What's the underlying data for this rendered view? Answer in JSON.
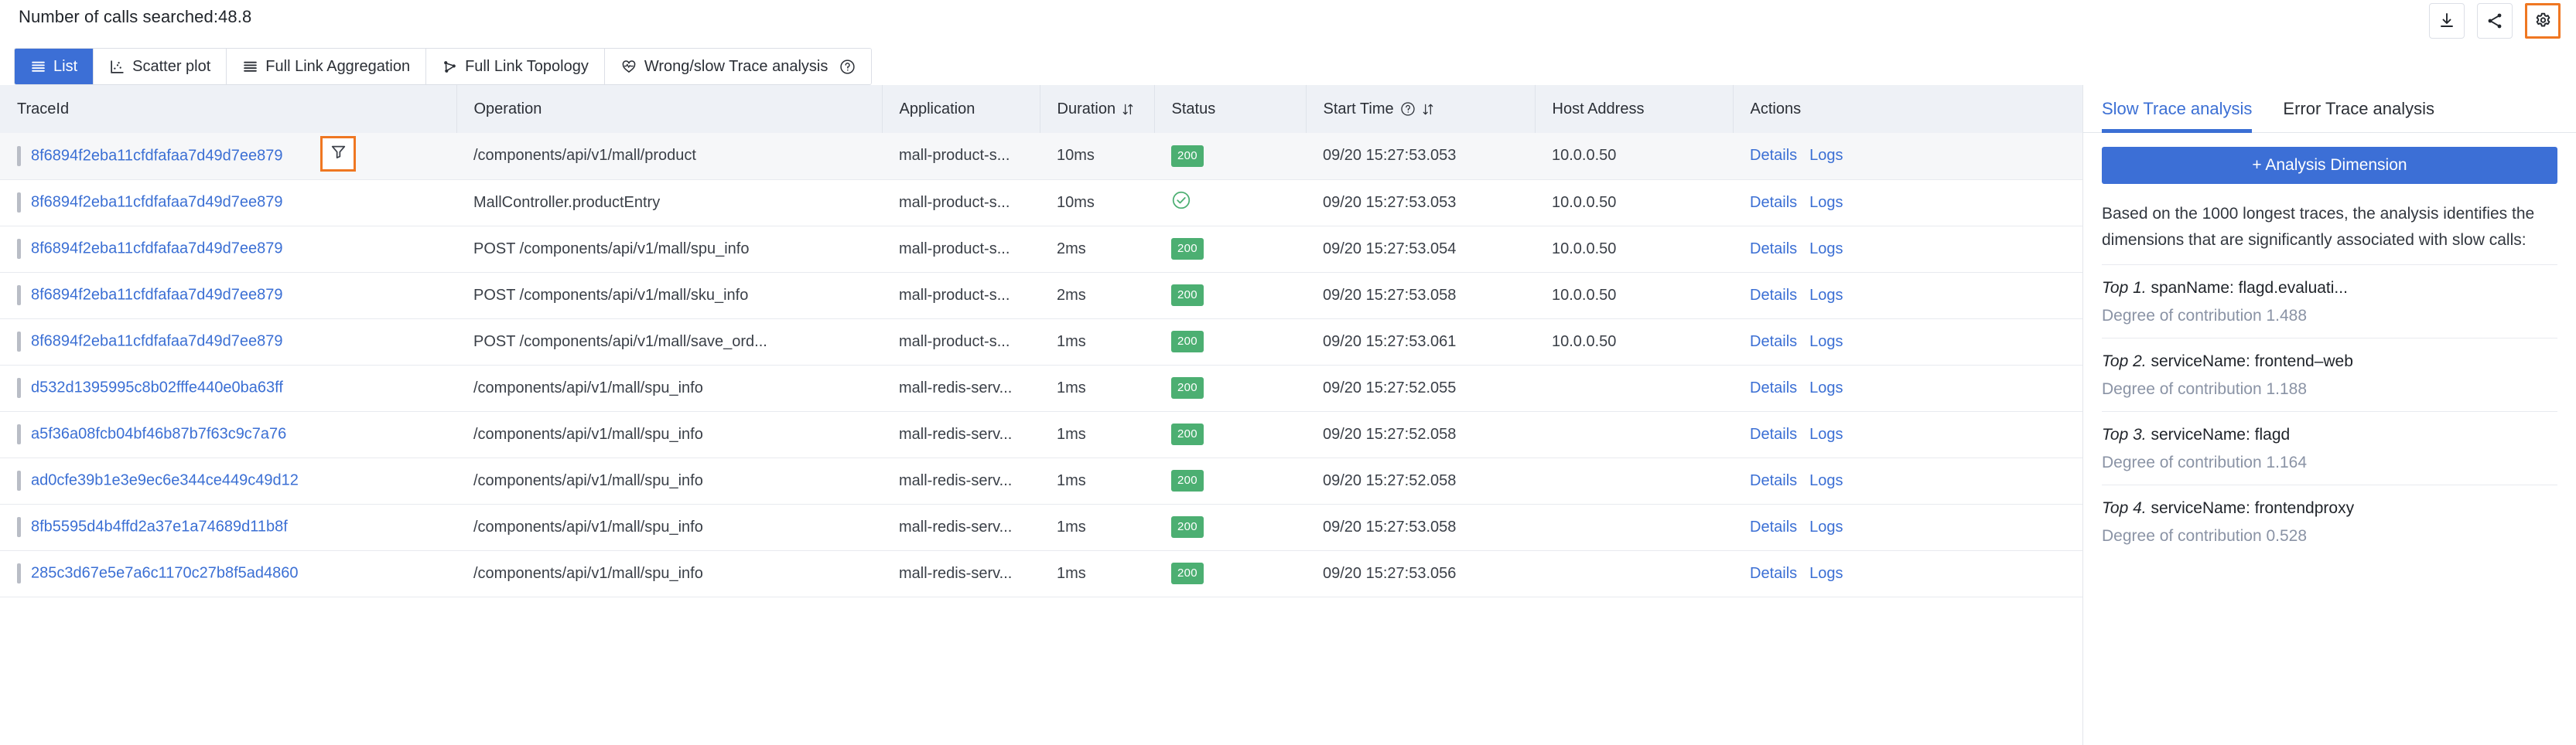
{
  "header": {
    "calls_searched_label": "Number of calls searched:48.8",
    "actions": [
      {
        "name": "download-button",
        "icon": "download-icon",
        "highlighted": false
      },
      {
        "name": "share-button",
        "icon": "share-icon",
        "highlighted": false
      },
      {
        "name": "settings-button",
        "icon": "gear-icon",
        "highlighted": true
      }
    ]
  },
  "tabs": [
    {
      "label": "List",
      "icon": "list-icon",
      "active": true,
      "help": false
    },
    {
      "label": "Scatter plot",
      "icon": "scatter-plot-icon",
      "active": false,
      "help": false
    },
    {
      "label": "Full Link Aggregation",
      "icon": "list-icon",
      "active": false,
      "help": false
    },
    {
      "label": "Full Link Topology",
      "icon": "topology-icon",
      "active": false,
      "help": false
    },
    {
      "label": "Wrong/slow Trace analysis",
      "icon": "heart-pulse-icon",
      "active": false,
      "help": true
    }
  ],
  "table": {
    "columns": [
      {
        "key": "traceId",
        "label": "TraceId",
        "sortable": false,
        "help": false
      },
      {
        "key": "operation",
        "label": "Operation",
        "sortable": false,
        "help": false
      },
      {
        "key": "application",
        "label": "Application",
        "sortable": false,
        "help": false
      },
      {
        "key": "duration",
        "label": "Duration",
        "sortable": true,
        "help": false
      },
      {
        "key": "status",
        "label": "Status",
        "sortable": false,
        "help": false
      },
      {
        "key": "startTime",
        "label": "Start Time",
        "sortable": true,
        "help": true
      },
      {
        "key": "hostAddress",
        "label": "Host Address",
        "sortable": false,
        "help": false
      },
      {
        "key": "actions",
        "label": "Actions",
        "sortable": false,
        "help": false
      }
    ],
    "action_links": {
      "details": "Details",
      "logs": "Logs"
    },
    "rows": [
      {
        "traceId": "8f6894f2eba11cfdfafaa7d49d7ee879",
        "operation": "/components/api/v1/mall/product",
        "application": "mall-product-s...",
        "duration": "10ms",
        "status_type": "code",
        "status": "200",
        "startTime": "09/20 15:27:53.053",
        "hostAddress": "10.0.0.50",
        "has_filter_icon": true
      },
      {
        "traceId": "8f6894f2eba11cfdfafaa7d49d7ee879",
        "operation": "MallController.productEntry",
        "application": "mall-product-s...",
        "duration": "10ms",
        "status_type": "ok",
        "status": "",
        "startTime": "09/20 15:27:53.053",
        "hostAddress": "10.0.0.50",
        "has_filter_icon": false
      },
      {
        "traceId": "8f6894f2eba11cfdfafaa7d49d7ee879",
        "operation": "POST /components/api/v1/mall/spu_info",
        "application": "mall-product-s...",
        "duration": "2ms",
        "status_type": "code",
        "status": "200",
        "startTime": "09/20 15:27:53.054",
        "hostAddress": "10.0.0.50",
        "has_filter_icon": false
      },
      {
        "traceId": "8f6894f2eba11cfdfafaa7d49d7ee879",
        "operation": "POST /components/api/v1/mall/sku_info",
        "application": "mall-product-s...",
        "duration": "2ms",
        "status_type": "code",
        "status": "200",
        "startTime": "09/20 15:27:53.058",
        "hostAddress": "10.0.0.50",
        "has_filter_icon": false
      },
      {
        "traceId": "8f6894f2eba11cfdfafaa7d49d7ee879",
        "operation": "POST /components/api/v1/mall/save_ord...",
        "application": "mall-product-s...",
        "duration": "1ms",
        "status_type": "code",
        "status": "200",
        "startTime": "09/20 15:27:53.061",
        "hostAddress": "10.0.0.50",
        "has_filter_icon": false
      },
      {
        "traceId": "d532d1395995c8b02fffe440e0ba63ff",
        "operation": "/components/api/v1/mall/spu_info",
        "application": "mall-redis-serv...",
        "duration": "1ms",
        "status_type": "code",
        "status": "200",
        "startTime": "09/20 15:27:52.055",
        "hostAddress": "",
        "has_filter_icon": false
      },
      {
        "traceId": "a5f36a08fcb04bf46b87b7f63c9c7a76",
        "operation": "/components/api/v1/mall/spu_info",
        "application": "mall-redis-serv...",
        "duration": "1ms",
        "status_type": "code",
        "status": "200",
        "startTime": "09/20 15:27:52.058",
        "hostAddress": "",
        "has_filter_icon": false
      },
      {
        "traceId": "ad0cfe39b1e3e9ec6e344ce449c49d12",
        "operation": "/components/api/v1/mall/spu_info",
        "application": "mall-redis-serv...",
        "duration": "1ms",
        "status_type": "code",
        "status": "200",
        "startTime": "09/20 15:27:52.058",
        "hostAddress": "",
        "has_filter_icon": false
      },
      {
        "traceId": "8fb5595d4b4ffd2a37e1a74689d11b8f",
        "operation": "/components/api/v1/mall/spu_info",
        "application": "mall-redis-serv...",
        "duration": "1ms",
        "status_type": "code",
        "status": "200",
        "startTime": "09/20 15:27:53.058",
        "hostAddress": "",
        "has_filter_icon": false
      },
      {
        "traceId": "285c3d67e5e7a6c1170c27b8f5ad4860",
        "operation": "/components/api/v1/mall/spu_info",
        "application": "mall-redis-serv...",
        "duration": "1ms",
        "status_type": "code",
        "status": "200",
        "startTime": "09/20 15:27:53.056",
        "hostAddress": "",
        "has_filter_icon": false
      }
    ]
  },
  "side_panel": {
    "tabs": [
      {
        "label": "Slow Trace analysis",
        "active": true
      },
      {
        "label": "Error Trace analysis",
        "active": false
      }
    ],
    "add_dimension_button": "+ Analysis Dimension",
    "description": "Based on the 1000 longest traces, the analysis identifies the dimensions that are significantly associated with slow calls:",
    "top_items": [
      {
        "rank": "Top 1.",
        "dimension": "spanName: flagd.evaluati...",
        "contribution": "Degree of contribution 1.488"
      },
      {
        "rank": "Top 2.",
        "dimension": "serviceName: frontend–web",
        "contribution": "Degree of contribution 1.188"
      },
      {
        "rank": "Top 3.",
        "dimension": "serviceName: flagd",
        "contribution": "Degree of contribution 1.164"
      },
      {
        "rank": "Top 4.",
        "dimension": "serviceName: frontendproxy",
        "contribution": "Degree of contribution 0.528"
      }
    ]
  },
  "colors": {
    "accent_blue": "#3c6fd6",
    "link_blue": "#3b6fd4",
    "status_green": "#4caf72",
    "highlight_orange": "#ef7722",
    "header_grey": "#eef1f6"
  }
}
